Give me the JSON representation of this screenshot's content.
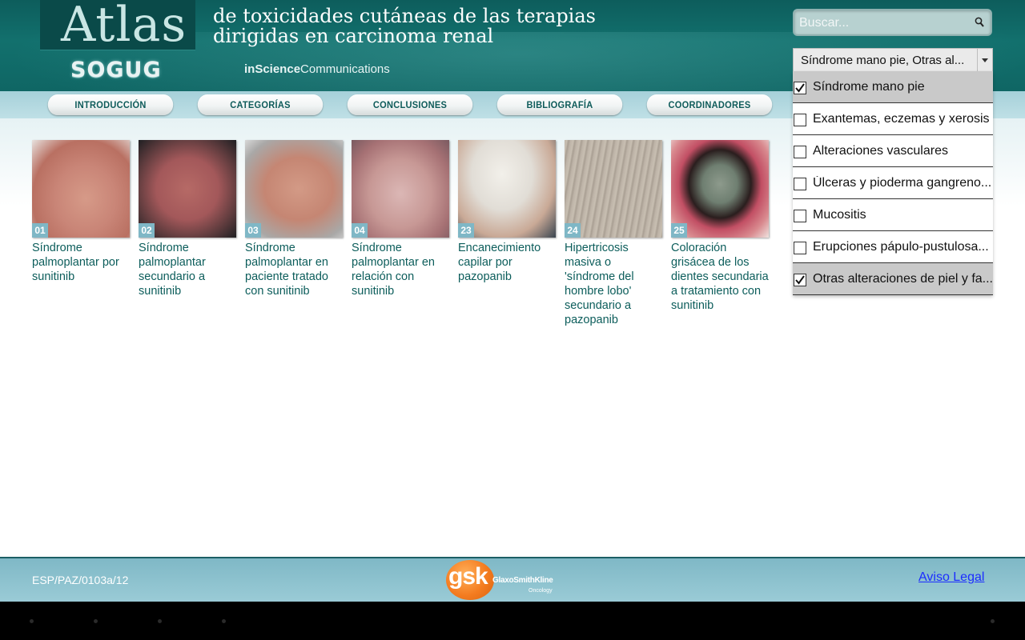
{
  "header": {
    "atlas": "Atlas",
    "subtitle_line1": "de toxicidades cutáneas de las terapias",
    "subtitle_line2": "dirigidas en carcinoma renal",
    "society": "SOGUG",
    "publisher_bold": "inScience",
    "publisher_rest": "Communications"
  },
  "search": {
    "placeholder": "Buscar...",
    "value": ""
  },
  "category_select": {
    "value": "Síndrome mano pie, Otras al..."
  },
  "nav": {
    "items": [
      {
        "label": "INTRODUCCIÓN"
      },
      {
        "label": "CATEGORÍAS"
      },
      {
        "label": "CONCLUSIONES"
      },
      {
        "label": "BIBLIOGRAFÍA"
      },
      {
        "label": "COORDINADORES"
      }
    ]
  },
  "thumbnails": [
    {
      "num": "01",
      "caption": "Síndrome palmoplantar por sunitinib",
      "img": "img-hand1"
    },
    {
      "num": "02",
      "caption": "Síndrome palmoplantar secundario a sunitinib",
      "img": "img-hand2"
    },
    {
      "num": "03",
      "caption": "Síndrome palmoplantar en paciente tratado con sunitinib",
      "img": "img-hand3"
    },
    {
      "num": "04",
      "caption": "Síndrome palmoplantar en relación con sunitinib",
      "img": "img-foot"
    },
    {
      "num": "23",
      "caption": "Encanecimiento capilar por pazopanib",
      "img": "img-hair"
    },
    {
      "num": "24",
      "caption": "Hipertricosis masiva o 'síndrome del hombre lobo' secundario a pazopanib",
      "img": "img-skin"
    },
    {
      "num": "25",
      "caption": "Coloración grisácea de los dientes secundaria a tratamiento con sunitinib",
      "img": "img-teeth"
    }
  ],
  "dropdown": {
    "items": [
      {
        "label": "Síndrome mano pie",
        "checked": true
      },
      {
        "label": "Exantemas, eczemas y xerosis",
        "checked": false
      },
      {
        "label": "Alteraciones vasculares",
        "checked": false
      },
      {
        "label": "Úlceras y pioderma gangreno...",
        "checked": false
      },
      {
        "label": "Mucositis",
        "checked": false
      },
      {
        "label": "Erupciones pápulo-pustulosa...",
        "checked": false
      },
      {
        "label": "Otras alteraciones de piel y fa...",
        "checked": true
      }
    ]
  },
  "footer": {
    "code": "ESP/PAZ/0103a/12",
    "sponsor_mark": "gsk",
    "sponsor_name": "GlaxoSmithKline",
    "sponsor_division": "Oncology",
    "legal_link": "Aviso Legal"
  },
  "colors": {
    "header_bg": "#12706d",
    "link_text": "#0c5d5b",
    "number_badge": "#7fb7c6",
    "gsk_orange": "#f47c20"
  }
}
